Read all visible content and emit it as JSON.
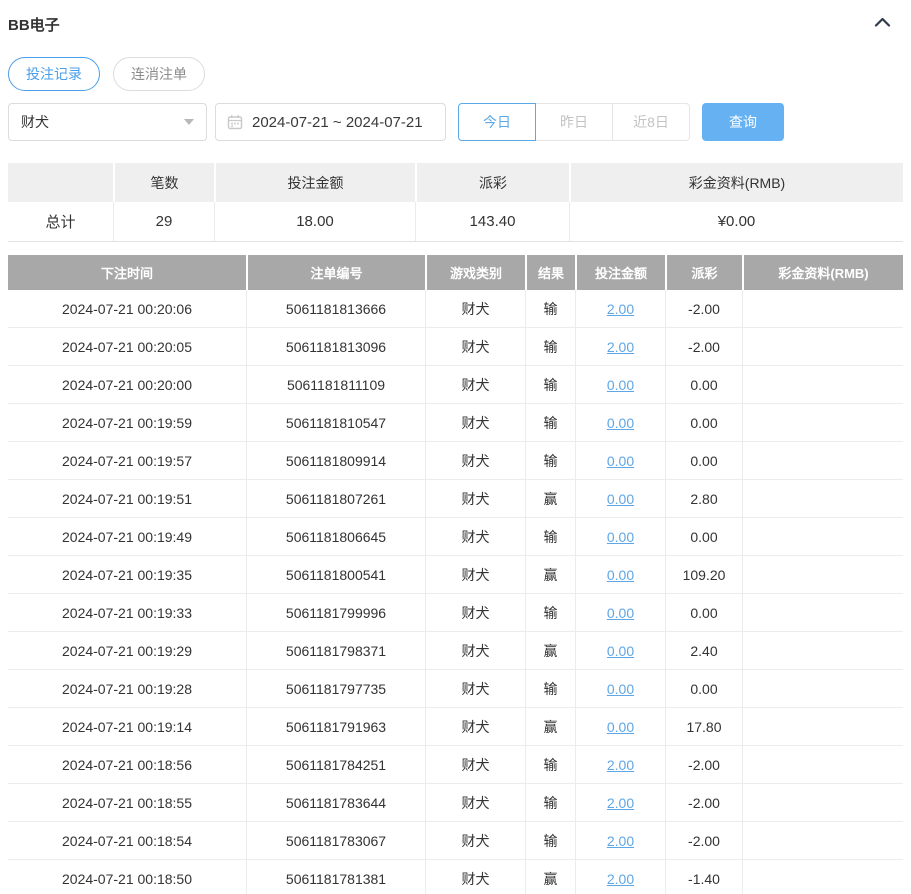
{
  "header": {
    "title": "BB电子"
  },
  "tabs": [
    {
      "label": "投注记录",
      "active": true
    },
    {
      "label": "连消注单",
      "active": false
    }
  ],
  "filters": {
    "game_select": {
      "value": "财犬"
    },
    "date_range": {
      "value": "2024-07-21 ~ 2024-07-21"
    },
    "quick_buttons": [
      {
        "label": "今日",
        "active": true
      },
      {
        "label": "昨日",
        "active": false
      },
      {
        "label": "近8日",
        "active": false
      }
    ],
    "search_label": "查询"
  },
  "summary": {
    "headers": [
      "",
      "笔数",
      "投注金额",
      "派彩",
      "彩金资料(RMB)"
    ],
    "row": {
      "label": "总计",
      "count": "29",
      "bet_amount": "18.00",
      "payout": "143.40",
      "bonus": "¥0.00"
    }
  },
  "table": {
    "headers": [
      "下注时间",
      "注单编号",
      "游戏类别",
      "结果",
      "投注金额",
      "派彩",
      "彩金资料(RMB)"
    ],
    "rows": [
      {
        "time": "2024-07-21 00:20:06",
        "bet_no": "5061181813666",
        "game": "财犬",
        "result": "输",
        "amount": "2.00",
        "payout": "-2.00",
        "bonus": ""
      },
      {
        "time": "2024-07-21 00:20:05",
        "bet_no": "5061181813096",
        "game": "财犬",
        "result": "输",
        "amount": "2.00",
        "payout": "-2.00",
        "bonus": ""
      },
      {
        "time": "2024-07-21 00:20:00",
        "bet_no": "5061181811109",
        "game": "财犬",
        "result": "输",
        "amount": "0.00",
        "payout": "0.00",
        "bonus": ""
      },
      {
        "time": "2024-07-21 00:19:59",
        "bet_no": "5061181810547",
        "game": "财犬",
        "result": "输",
        "amount": "0.00",
        "payout": "0.00",
        "bonus": ""
      },
      {
        "time": "2024-07-21 00:19:57",
        "bet_no": "5061181809914",
        "game": "财犬",
        "result": "输",
        "amount": "0.00",
        "payout": "0.00",
        "bonus": ""
      },
      {
        "time": "2024-07-21 00:19:51",
        "bet_no": "5061181807261",
        "game": "财犬",
        "result": "赢",
        "amount": "0.00",
        "payout": "2.80",
        "bonus": ""
      },
      {
        "time": "2024-07-21 00:19:49",
        "bet_no": "5061181806645",
        "game": "财犬",
        "result": "输",
        "amount": "0.00",
        "payout": "0.00",
        "bonus": ""
      },
      {
        "time": "2024-07-21 00:19:35",
        "bet_no": "5061181800541",
        "game": "财犬",
        "result": "赢",
        "amount": "0.00",
        "payout": "109.20",
        "bonus": ""
      },
      {
        "time": "2024-07-21 00:19:33",
        "bet_no": "5061181799996",
        "game": "财犬",
        "result": "输",
        "amount": "0.00",
        "payout": "0.00",
        "bonus": ""
      },
      {
        "time": "2024-07-21 00:19:29",
        "bet_no": "5061181798371",
        "game": "财犬",
        "result": "赢",
        "amount": "0.00",
        "payout": "2.40",
        "bonus": ""
      },
      {
        "time": "2024-07-21 00:19:28",
        "bet_no": "5061181797735",
        "game": "财犬",
        "result": "输",
        "amount": "0.00",
        "payout": "0.00",
        "bonus": ""
      },
      {
        "time": "2024-07-21 00:19:14",
        "bet_no": "5061181791963",
        "game": "财犬",
        "result": "赢",
        "amount": "0.00",
        "payout": "17.80",
        "bonus": ""
      },
      {
        "time": "2024-07-21 00:18:56",
        "bet_no": "5061181784251",
        "game": "财犬",
        "result": "输",
        "amount": "2.00",
        "payout": "-2.00",
        "bonus": ""
      },
      {
        "time": "2024-07-21 00:18:55",
        "bet_no": "5061181783644",
        "game": "财犬",
        "result": "输",
        "amount": "2.00",
        "payout": "-2.00",
        "bonus": ""
      },
      {
        "time": "2024-07-21 00:18:54",
        "bet_no": "5061181783067",
        "game": "财犬",
        "result": "输",
        "amount": "2.00",
        "payout": "-2.00",
        "bonus": ""
      },
      {
        "time": "2024-07-21 00:18:50",
        "bet_no": "5061181781381",
        "game": "财犬",
        "result": "赢",
        "amount": "2.00",
        "payout": "-1.40",
        "bonus": ""
      }
    ]
  },
  "colors": {
    "accent_blue": "#4a9eea",
    "button_blue": "#66b1f1",
    "link_blue": "#5fa6e4",
    "negative_red": "#e05c5f",
    "table_header_grey": "#a8a8a8",
    "summary_header_grey": "#efefef"
  }
}
